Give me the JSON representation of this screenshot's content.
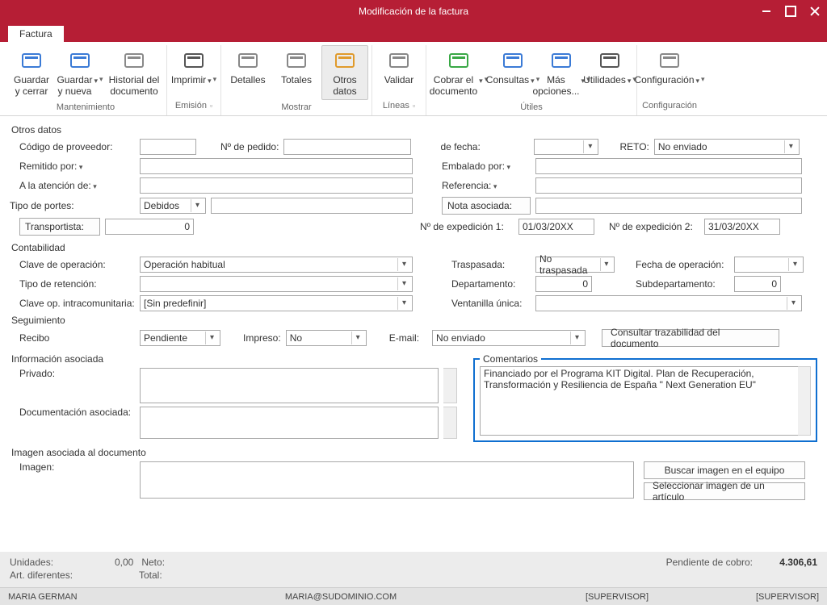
{
  "window": {
    "title": "Modificación de la factura"
  },
  "tab": {
    "label": "Factura"
  },
  "ribbon": {
    "groups": [
      {
        "title": "Mantenimiento",
        "launcher": false,
        "buttons": [
          {
            "label": "Guardar y cerrar",
            "icon": "save-close-icon",
            "dd": false
          },
          {
            "label": "Guardar y nueva",
            "icon": "save-new-icon",
            "dd": true
          },
          {
            "label": "Historial del documento",
            "icon": "history-icon",
            "dd": false,
            "wide": true
          }
        ]
      },
      {
        "title": "Emisión",
        "launcher": true,
        "buttons": [
          {
            "label": "Imprimir",
            "icon": "print-icon",
            "dd": true
          }
        ]
      },
      {
        "title": "Mostrar",
        "launcher": false,
        "buttons": [
          {
            "label": "Detalles",
            "icon": "details-icon"
          },
          {
            "label": "Totales",
            "icon": "totals-icon"
          },
          {
            "label": "Otros datos",
            "icon": "other-data-icon",
            "selected": true
          }
        ]
      },
      {
        "title": "Líneas",
        "launcher": true,
        "buttons": [
          {
            "label": "Validar",
            "icon": "validate-icon"
          }
        ]
      },
      {
        "title": "Útiles",
        "launcher": false,
        "buttons": [
          {
            "label": "Cobrar el documento",
            "icon": "collect-icon",
            "dd": true,
            "wide": true
          },
          {
            "label": "Consultas",
            "icon": "queries-icon",
            "dd": true
          },
          {
            "label": "Más opciones...",
            "icon": "more-icon",
            "dd": true
          },
          {
            "label": "Utilidades",
            "icon": "utilities-icon",
            "dd": true
          }
        ]
      },
      {
        "title": "Configuración",
        "launcher": false,
        "buttons": [
          {
            "label": "Configuración",
            "icon": "config-icon",
            "dd": true,
            "wide": true
          }
        ]
      }
    ]
  },
  "sections": {
    "otros_datos": {
      "title": "Otros datos",
      "codigo_proveedor_label": "Código de proveedor:",
      "codigo_proveedor": "",
      "n_pedido_label": "Nº de pedido:",
      "n_pedido": "",
      "de_fecha_label": "de fecha:",
      "de_fecha": "",
      "reto_label": "RETO:",
      "reto": "No enviado",
      "remitido_label": "Remitido por:",
      "remitido": "",
      "embalado_label": "Embalado por:",
      "embalado": "",
      "atencion_label": "A la atención de:",
      "atencion": "",
      "referencia_label": "Referencia:",
      "referencia": "",
      "tipo_portes_label": "Tipo de portes:",
      "tipo_portes": "Debidos",
      "portes_extra": "",
      "nota_label": "Nota asociada:",
      "nota": "",
      "transportista_label": "Transportista:",
      "transportista": "0",
      "exped1_label": "Nº de expedición 1:",
      "exped1": "01/03/20XX",
      "exped2_label": "Nº de expedición 2:",
      "exped2": "31/03/20XX"
    },
    "contabilidad": {
      "title": "Contabilidad",
      "clave_label": "Clave de operación:",
      "clave": "Operación habitual",
      "traspasada_label": "Traspasada:",
      "traspasada": "No traspasada",
      "fecha_op_label": "Fecha de operación:",
      "fecha_op": "",
      "retencion_label": "Tipo de retención:",
      "retencion": "",
      "departamento_label": "Departamento:",
      "departamento": "0",
      "subdep_label": "Subdepartamento:",
      "subdep": "0",
      "intracom_label": "Clave op. intracomunitaria:",
      "intracom": "[Sin predefinir]",
      "ventanilla_label": "Ventanilla única:",
      "ventanilla": ""
    },
    "seguimiento": {
      "title": "Seguimiento",
      "recibo_label": "Recibo",
      "recibo": "Pendiente",
      "impreso_label": "Impreso:",
      "impreso": "No",
      "email_label": "E-mail:",
      "email": "No enviado",
      "consultar_btn": "Consultar trazabilidad del documento"
    },
    "info": {
      "title": "Información asociada",
      "privado_label": "Privado:",
      "privado": "",
      "doc_label": "Documentación asociada:",
      "doc": "",
      "comentarios_legend": "Comentarios",
      "comentarios": "Financiado por el Programa KIT Digital. Plan de Recuperación, Transformación y Resiliencia de España \" Next Generation EU\""
    },
    "imagen": {
      "title": "Imagen asociada al documento",
      "imagen_label": "Imagen:",
      "buscar_btn": "Buscar imagen en el equipo",
      "seleccionar_btn": "Seleccionar imagen de un artículo"
    }
  },
  "footer": {
    "unidades_label": "Unidades:",
    "unidades": "0,00",
    "neto_label": "Neto:",
    "art_label": "Art. diferentes:",
    "total_label": "Total:",
    "pendiente_label": "Pendiente de cobro:",
    "pendiente": "4.306,61"
  },
  "statusbar": {
    "user": "MARIA GERMAN",
    "email": "MARIA@SUDOMINIO.COM",
    "role1": "[SUPERVISOR]",
    "role2": "[SUPERVISOR]"
  },
  "icons": {
    "save-close-icon": "#3b7bd6",
    "save-new-icon": "#3b7bd6",
    "history-icon": "#8a8a8a",
    "print-icon": "#555",
    "details-icon": "#888",
    "totals-icon": "#888",
    "other-data-icon": "#e09a2b",
    "validate-icon": "#888",
    "collect-icon": "#39a845",
    "queries-icon": "#3b7bd6",
    "more-icon": "#3b7bd6",
    "utilities-icon": "#555",
    "config-icon": "#888"
  }
}
